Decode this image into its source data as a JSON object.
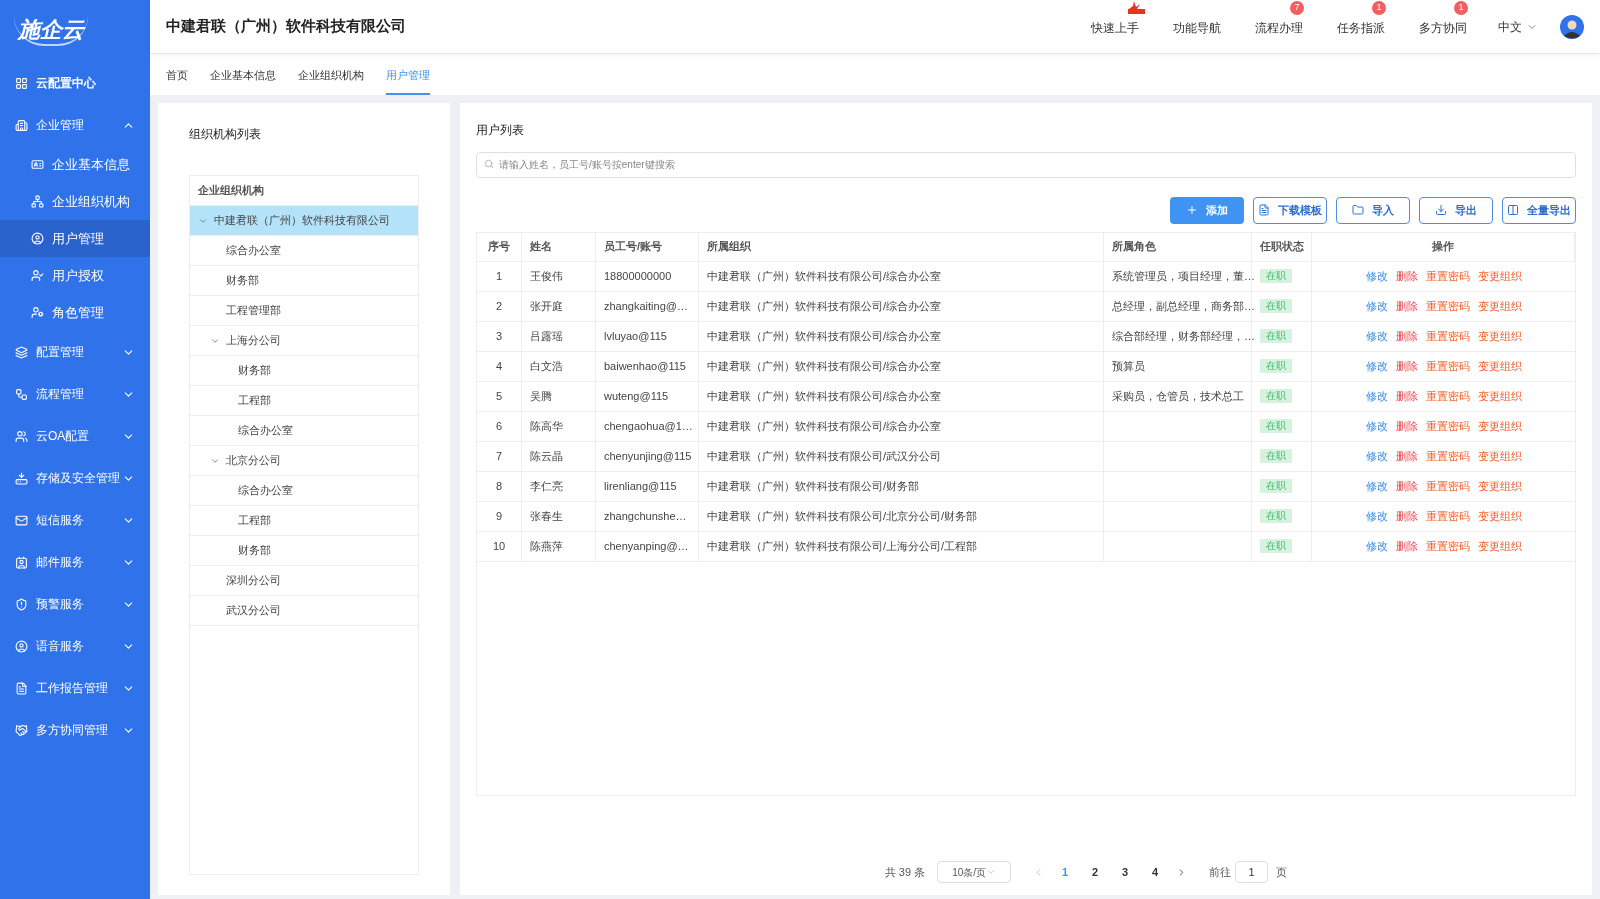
{
  "sidebar": {
    "logo": "施企云",
    "items": [
      {
        "label": "云配置中心",
        "kind": "link"
      },
      {
        "label": "企业管理",
        "kind": "group",
        "expanded": true,
        "children": [
          {
            "label": "企业基本信息",
            "selected": false
          },
          {
            "label": "企业组织机构",
            "selected": false
          },
          {
            "label": "用户管理",
            "selected": true
          },
          {
            "label": "用户授权",
            "selected": false
          },
          {
            "label": "角色管理",
            "selected": false
          }
        ]
      },
      {
        "label": "配置管理",
        "kind": "group",
        "expanded": false
      },
      {
        "label": "流程管理",
        "kind": "group",
        "expanded": false
      },
      {
        "label": "云OA配置",
        "kind": "group",
        "expanded": false
      },
      {
        "label": "存储及安全管理",
        "kind": "group",
        "expanded": false
      },
      {
        "label": "短信服务",
        "kind": "group",
        "expanded": false
      },
      {
        "label": "邮件服务",
        "kind": "group",
        "expanded": false
      },
      {
        "label": "预警服务",
        "kind": "group",
        "expanded": false
      },
      {
        "label": "语音服务",
        "kind": "group",
        "expanded": false
      },
      {
        "label": "工作报告管理",
        "kind": "group",
        "expanded": false
      },
      {
        "label": "多方协同管理",
        "kind": "group",
        "expanded": false
      }
    ]
  },
  "header": {
    "title": "中建君联（广州）软件科技有限公司",
    "nav": [
      {
        "label": "快速上手",
        "kind": "hot"
      },
      {
        "label": "功能导航",
        "kind": "plain"
      },
      {
        "label": "流程办理",
        "kind": "count",
        "count": "7"
      },
      {
        "label": "任务指派",
        "kind": "count",
        "count": "1"
      },
      {
        "label": "多方协同",
        "kind": "count",
        "count": "1"
      }
    ],
    "language": "中文"
  },
  "tabs": [
    {
      "label": "首页",
      "selected": false
    },
    {
      "label": "企业基本信息",
      "selected": false
    },
    {
      "label": "企业组织机构",
      "selected": false
    },
    {
      "label": "用户管理",
      "selected": true
    }
  ],
  "org_panel": {
    "title": "组织机构列表",
    "tree_header": "企业组织机构",
    "tree": [
      {
        "label": "中建君联（广州）软件科技有限公司",
        "selected": true,
        "expanded": true,
        "children": [
          {
            "label": "综合办公室",
            "selected": false
          },
          {
            "label": "财务部",
            "selected": false
          },
          {
            "label": "工程管理部",
            "selected": false
          },
          {
            "label": "上海分公司",
            "selected": false,
            "expanded": true,
            "children": [
              {
                "label": "财务部",
                "selected": false
              },
              {
                "label": "工程部",
                "selected": false
              },
              {
                "label": "综合办公室",
                "selected": false
              }
            ]
          },
          {
            "label": "北京分公司",
            "selected": false,
            "expanded": true,
            "children": [
              {
                "label": "综合办公室",
                "selected": false
              },
              {
                "label": "工程部",
                "selected": false
              },
              {
                "label": "财务部",
                "selected": false
              }
            ]
          },
          {
            "label": "深圳分公司",
            "selected": false
          },
          {
            "label": "武汉分公司",
            "selected": false
          }
        ]
      }
    ]
  },
  "user_panel": {
    "title": "用户列表",
    "search": {
      "placeholder": "请输入姓名，员工号/账号按enter键搜索"
    },
    "buttons": [
      {
        "label": "添加",
        "kind": "primary"
      },
      {
        "label": "下载模板",
        "kind": "file"
      },
      {
        "label": "导入",
        "kind": "folder"
      },
      {
        "label": "导出",
        "kind": "download"
      },
      {
        "label": "全量导出",
        "kind": "columns"
      }
    ],
    "table": {
      "columns": [
        "序号",
        "姓名",
        "员工号/账号",
        "所属组织",
        "所属角色",
        "任职状态",
        "操作"
      ],
      "rows": [
        {
          "index": "1",
          "name": "王俊伟",
          "account": "18800000000",
          "org": "中建君联（广州）软件科技有限公司/综合办公室",
          "roles": "系统管理员，项目经理，董…",
          "status": "在职",
          "actions": [
            {
              "label": "修改",
              "kind": "edit"
            },
            {
              "label": "删除",
              "kind": "delete"
            },
            {
              "label": "重置密码",
              "kind": "warn"
            },
            {
              "label": "变更组织",
              "kind": "warn"
            }
          ]
        },
        {
          "index": "2",
          "name": "张开庭",
          "account": "zhangkaiting@…",
          "org": "中建君联（广州）软件科技有限公司/综合办公室",
          "roles": "总经理，副总经理，商务部…",
          "status": "在职",
          "actions": [
            {
              "label": "修改",
              "kind": "edit"
            },
            {
              "label": "删除",
              "kind": "delete"
            },
            {
              "label": "重置密码",
              "kind": "warn"
            },
            {
              "label": "变更组织",
              "kind": "warn"
            }
          ]
        },
        {
          "index": "3",
          "name": "吕露瑶",
          "account": "lvluyao@115",
          "org": "中建君联（广州）软件科技有限公司/综合办公室",
          "roles": "综合部经理，财务部经理，…",
          "status": "在职",
          "actions": [
            {
              "label": "修改",
              "kind": "edit"
            },
            {
              "label": "删除",
              "kind": "delete"
            },
            {
              "label": "重置密码",
              "kind": "warn"
            },
            {
              "label": "变更组织",
              "kind": "warn"
            }
          ]
        },
        {
          "index": "4",
          "name": "白文浩",
          "account": "baiwenhao@115",
          "org": "中建君联（广州）软件科技有限公司/综合办公室",
          "roles": "预算员",
          "status": "在职",
          "actions": [
            {
              "label": "修改",
              "kind": "edit"
            },
            {
              "label": "删除",
              "kind": "delete"
            },
            {
              "label": "重置密码",
              "kind": "warn"
            },
            {
              "label": "变更组织",
              "kind": "warn"
            }
          ]
        },
        {
          "index": "5",
          "name": "吴腾",
          "account": "wuteng@115",
          "org": "中建君联（广州）软件科技有限公司/综合办公室",
          "roles": "采购员，仓管员，技术总工",
          "status": "在职",
          "actions": [
            {
              "label": "修改",
              "kind": "edit"
            },
            {
              "label": "删除",
              "kind": "delete"
            },
            {
              "label": "重置密码",
              "kind": "warn"
            },
            {
              "label": "变更组织",
              "kind": "warn"
            }
          ]
        },
        {
          "index": "6",
          "name": "陈高华",
          "account": "chengaohua@1…",
          "org": "中建君联（广州）软件科技有限公司/综合办公室",
          "status": "在职",
          "actions": [
            {
              "label": "修改",
              "kind": "edit"
            },
            {
              "label": "删除",
              "kind": "delete"
            },
            {
              "label": "重置密码",
              "kind": "warn"
            },
            {
              "label": "变更组织",
              "kind": "warn"
            }
          ]
        },
        {
          "index": "7",
          "name": "陈云晶",
          "account": "chenyunjing@115",
          "org": "中建君联（广州）软件科技有限公司/武汉分公司",
          "status": "在职",
          "actions": [
            {
              "label": "修改",
              "kind": "edit"
            },
            {
              "label": "删除",
              "kind": "delete"
            },
            {
              "label": "重置密码",
              "kind": "warn"
            },
            {
              "label": "变更组织",
              "kind": "warn"
            }
          ]
        },
        {
          "index": "8",
          "name": "李仁亮",
          "account": "lirenliang@115",
          "org": "中建君联（广州）软件科技有限公司/财务部",
          "status": "在职",
          "actions": [
            {
              "label": "修改",
              "kind": "edit"
            },
            {
              "label": "删除",
              "kind": "delete"
            },
            {
              "label": "重置密码",
              "kind": "warn"
            },
            {
              "label": "变更组织",
              "kind": "warn"
            }
          ]
        },
        {
          "index": "9",
          "name": "张春生",
          "account": "zhangchunshe…",
          "org": "中建君联（广州）软件科技有限公司/北京分公司/财务部",
          "status": "在职",
          "actions": [
            {
              "label": "修改",
              "kind": "edit"
            },
            {
              "label": "删除",
              "kind": "delete"
            },
            {
              "label": "重置密码",
              "kind": "warn"
            },
            {
              "label": "变更组织",
              "kind": "warn"
            }
          ]
        },
        {
          "index": "10",
          "name": "陈燕萍",
          "account": "chenyanping@…",
          "org": "中建君联（广州）软件科技有限公司/上海分公司/工程部",
          "status": "在职",
          "actions": [
            {
              "label": "修改",
              "kind": "edit"
            },
            {
              "label": "删除",
              "kind": "delete"
            },
            {
              "label": "重置密码",
              "kind": "warn"
            },
            {
              "label": "变更组织",
              "kind": "warn"
            }
          ]
        }
      ]
    },
    "pagination": {
      "total": "共 39 条",
      "page_size": "10条/页",
      "pages": [
        {
          "label": "1",
          "selected": true
        },
        {
          "label": "2",
          "selected": false
        },
        {
          "label": "3",
          "selected": false
        },
        {
          "label": "4",
          "selected": false
        }
      ],
      "goto_label": "前往",
      "goto_value": "1",
      "goto_suffix": "页"
    }
  }
}
